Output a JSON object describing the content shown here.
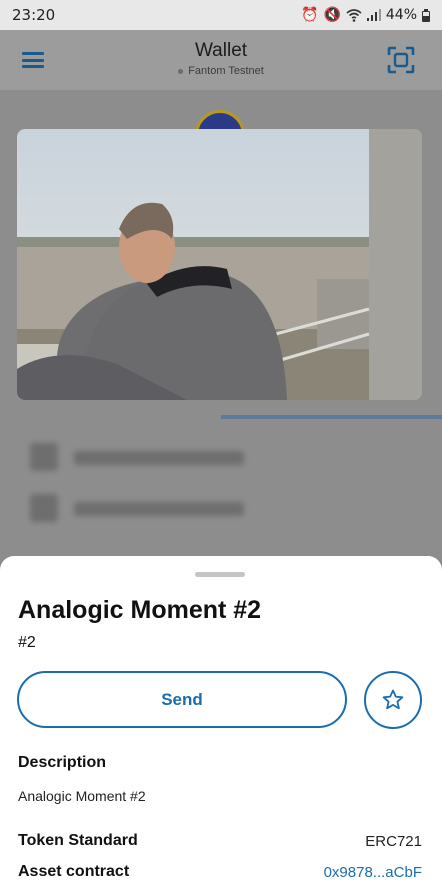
{
  "status_bar": {
    "time": "23:20",
    "battery": "44%"
  },
  "header": {
    "title": "Wallet",
    "network": "Fantom Testnet"
  },
  "nft": {
    "name": "Analogic Moment #2",
    "token_id": "#2",
    "send_label": "Send",
    "description_label": "Description",
    "description": "Analogic Moment #2",
    "token_standard_label": "Token Standard",
    "token_standard": "ERC721",
    "asset_contract_label": "Asset contract",
    "asset_contract": "0x9878...aCbF"
  },
  "colors": {
    "accent": "#1a6dae",
    "sheet_bg": "#ffffff",
    "overlay": "#8d8d8d"
  }
}
